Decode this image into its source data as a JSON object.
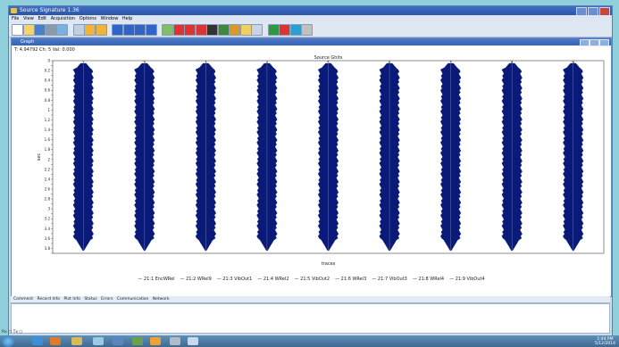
{
  "window": {
    "title": "Source Signature 1.36"
  },
  "menu": [
    "File",
    "View",
    "Edit",
    "Acquisition",
    "Options",
    "Window",
    "Help"
  ],
  "toolbar_icons": [
    "new-icon",
    "open-icon",
    "save-icon",
    "print-icon",
    "zoom-icon",
    "zoom-box-icon",
    "pick-icon",
    "overlay-icon",
    "wave-icon",
    "bend-up-icon",
    "bend-down-icon",
    "filter-icon",
    "display-icon",
    "trace-icon",
    "pulse-icon",
    "spike-icon",
    "camera-icon",
    "map-icon",
    "copy-icon",
    "folder-icon",
    "window-icon",
    "go-icon",
    "stop-icon",
    "record-icon",
    "disabled-icon"
  ],
  "child": {
    "title": "Graph",
    "readout": "T: 4.94792   Ch: 5   Val: 0.000"
  },
  "chart_data": {
    "type": "wiggle",
    "title": "Source Ghits",
    "xlabel": "traces",
    "ylabel": "sec",
    "ylim": [
      0,
      3.9
    ],
    "y_ticks": [
      "0",
      "0.1",
      "0.2",
      "0.3",
      "0.4",
      "0.5",
      "0.6",
      "0.7",
      "0.8",
      "0.9",
      "1",
      "1.1",
      "1.2",
      "1.3",
      "1.4",
      "1.5",
      "1.6",
      "1.7",
      "1.8",
      "1.9",
      "2",
      "2.1",
      "2.2",
      "2.3",
      "2.4",
      "2.5",
      "2.6",
      "2.7",
      "2.8",
      "2.9",
      "3",
      "3.1",
      "3.2",
      "3.3",
      "3.4",
      "3.5",
      "3.6",
      "3.7",
      "3.8",
      "3.9"
    ],
    "traces": [
      "1",
      "2",
      "3",
      "4",
      "5",
      "6",
      "7",
      "8",
      "9"
    ],
    "legend": [
      "21:1 EncWRel",
      "21:2 WRel9",
      "21:3 VibOut1",
      "21:4 WRel2",
      "21:5 VibOut2",
      "21:6 WRel3",
      "21:7 VibOut3",
      "21:8 WRel4",
      "21:9 VibOut4"
    ],
    "series_color": "#0a1a78"
  },
  "bottom_tabs": [
    "Comment",
    "Record Info",
    "Plot Info",
    "Status",
    "Errors",
    "Communication",
    "Network"
  ],
  "rxtx": "Rx ○   Tx ○",
  "taskbar": {
    "clock_time": "1:44 PM",
    "clock_date": "5/12/2014"
  }
}
